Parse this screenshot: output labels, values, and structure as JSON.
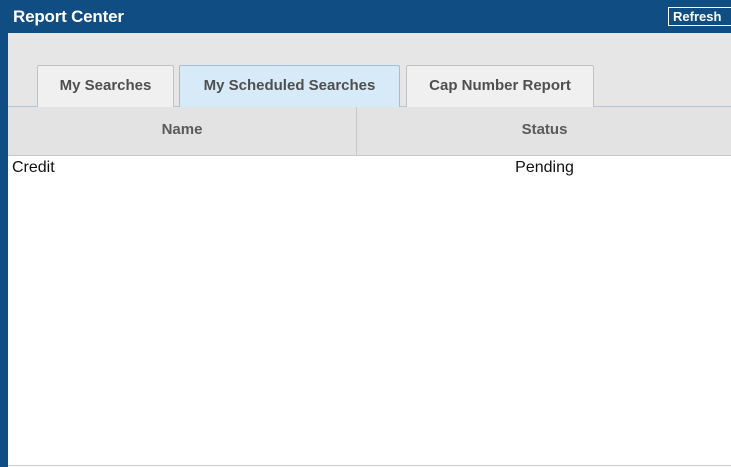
{
  "window": {
    "title": "Report Center",
    "refresh_label": "Refresh"
  },
  "tabs": [
    {
      "label": "My Searches",
      "active": false
    },
    {
      "label": "My Scheduled Searches",
      "active": true
    },
    {
      "label": "Cap Number Report",
      "active": false
    }
  ],
  "grid": {
    "columns": [
      "Name",
      "Status"
    ],
    "rows": [
      {
        "name": "Credit",
        "status": "Pending"
      }
    ]
  },
  "colors": {
    "titlebar": "#0f4d82",
    "active_tab": "#d6eaf8",
    "tabstrip": "#e6e6e6",
    "header": "#e3e3e3"
  }
}
